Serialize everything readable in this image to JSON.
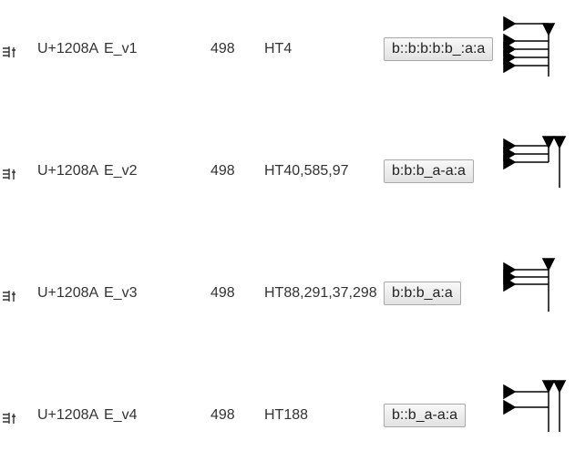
{
  "rows": [
    {
      "codepoint": "U+1208A",
      "variant": "E_v1",
      "number": "498",
      "refs": "HT4",
      "encoding": "b::b:b:b:b_:a:a"
    },
    {
      "codepoint": "U+1208A",
      "variant": "E_v2",
      "number": "498",
      "refs": "HT40,585,97",
      "encoding": "b:b:b_a-a:a"
    },
    {
      "codepoint": "U+1208A",
      "variant": "E_v3",
      "number": "498",
      "refs": "HT88,291,37,298",
      "encoding": "b:b:b_a:a"
    },
    {
      "codepoint": "U+1208A",
      "variant": "E_v4",
      "number": "498",
      "refs": "HT188",
      "encoding": "b::b_a-a:a"
    }
  ]
}
